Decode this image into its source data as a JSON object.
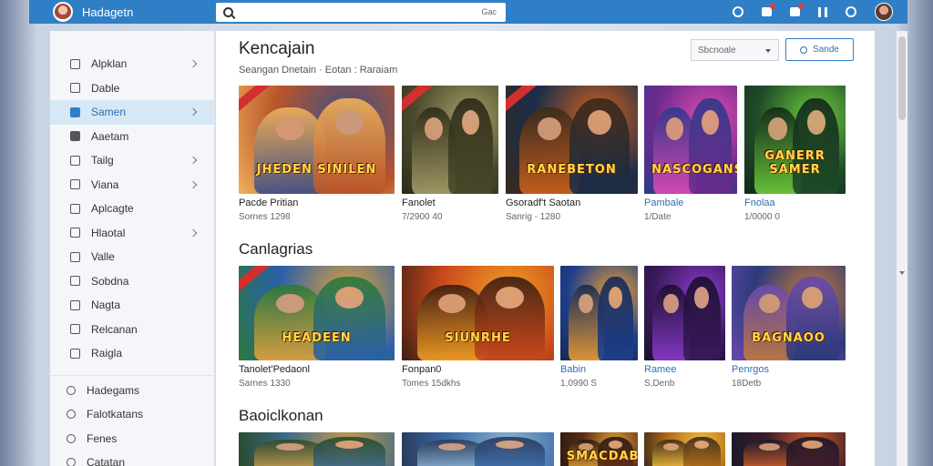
{
  "topbar": {
    "app_name": "Hadagetn",
    "search_placeholder": "",
    "search_hint": "Gac"
  },
  "sidebar": {
    "items": [
      {
        "label": "Alpklan",
        "icon": "grid-icon",
        "chevron": true
      },
      {
        "label": "Dable",
        "icon": "table-icon",
        "chevron": false
      },
      {
        "label": "Samen",
        "icon": "folder-icon",
        "chevron": true,
        "active": true
      },
      {
        "label": "Aaetam",
        "icon": "square-icon",
        "chevron": false
      },
      {
        "label": "Tailg",
        "icon": "tag-icon",
        "chevron": true
      },
      {
        "label": "Viana",
        "icon": "check-icon",
        "chevron": true
      },
      {
        "label": "Aplcagte",
        "icon": "app-icon",
        "chevron": false
      },
      {
        "label": "Hlaotal",
        "icon": "hotel-icon",
        "chevron": true
      },
      {
        "label": "Valle",
        "icon": "wallet-icon",
        "chevron": false
      },
      {
        "label": "Sobdna",
        "icon": "sound-icon",
        "chevron": false
      },
      {
        "label": "Nagta",
        "icon": "note-icon",
        "chevron": false
      },
      {
        "label": "Relcanan",
        "icon": "calendar-icon",
        "chevron": false
      },
      {
        "label": "Raigla",
        "icon": "image-icon",
        "chevron": false
      }
    ],
    "bottom_items": [
      {
        "label": "Hadegams",
        "icon": "settings-icon"
      },
      {
        "label": "Falotkatans",
        "icon": "feedback-icon"
      },
      {
        "label": "Fenes",
        "icon": "fence-icon"
      },
      {
        "label": "Catatan",
        "icon": "clock-icon"
      }
    ]
  },
  "main": {
    "title": "Kencajain",
    "subtitle": "Seangan Dnetain  ·  Eotan  :  Raraiam",
    "sort_label": "Sbcnoale",
    "find_label": "Sande",
    "sections": [
      {
        "title": "",
        "cards": [
          {
            "title": "Pacde Pritian",
            "meta": "Sornes 1298",
            "logo": "JHEDEN SINILEN",
            "colors": [
              "#b9542a",
              "#3b4f8a",
              "#f0b35a"
            ],
            "title_blue": false
          },
          {
            "title": "Fanolet",
            "meta": "7/2900 40",
            "logo": "",
            "colors": [
              "#4b4a2c",
              "#a7a06a",
              "#2d2a18"
            ],
            "title_blue": false
          },
          {
            "title": "Gsoradf't Saotan",
            "meta": "Sanrig - 1280",
            "logo": "RANEBETON",
            "colors": [
              "#1a2d4a",
              "#d4621a",
              "#3b2a1a"
            ],
            "title_blue": false
          },
          {
            "title": "Pambale",
            "meta": "1/Date",
            "logo": "NASCOGANS",
            "colors": [
              "#6b2b8c",
              "#e24bb4",
              "#2d3a8a"
            ],
            "title_blue": true
          },
          {
            "title": "Fnolaa",
            "meta": "1/0000 0",
            "logo": "GANERR SAMER",
            "colors": [
              "#1f4d2a",
              "#6fcf3c",
              "#13281a"
            ],
            "title_blue": true
          }
        ]
      },
      {
        "title": "Canlagrias",
        "cards": [
          {
            "title": "Tanolet'Pedaonl",
            "meta": "Sarnes 1330",
            "logo": "HEADEEN",
            "colors": [
              "#2a5fa8",
              "#e6a33a",
              "#2c7a3a"
            ],
            "title_blue": false
          },
          {
            "title": "Fonpan0",
            "meta": "Tomes 15dkhs",
            "logo": "SIUNRHE",
            "colors": [
              "#c9471c",
              "#f2a024",
              "#3a1e14"
            ],
            "title_blue": false
          },
          {
            "title": "Babin",
            "meta": "1,0990 S",
            "logo": "",
            "colors": [
              "#1d3f8a",
              "#f0a030",
              "#172a55"
            ],
            "title_blue": true
          },
          {
            "title": "Ramee",
            "meta": "S,Denb",
            "logo": "",
            "colors": [
              "#3a1a5c",
              "#8d3bd0",
              "#1a0f2e"
            ],
            "title_blue": true
          },
          {
            "title": "Penrgos",
            "meta": "18Detb",
            "logo": "BAGNAOO",
            "colors": [
              "#2c3a7a",
              "#c47a3a",
              "#6a4ab0"
            ],
            "title_blue": true
          }
        ]
      },
      {
        "title": "Baoiclkonan",
        "cards": [
          {
            "title": "",
            "meta": "",
            "logo": "",
            "colors": [
              "#3c6a8a",
              "#c79a4a",
              "#2a4a2a"
            ],
            "title_blue": false
          },
          {
            "title": "",
            "meta": "",
            "logo": "",
            "colors": [
              "#3a6aa8",
              "#8ab0d0",
              "#2a3a5a"
            ],
            "title_blue": false
          },
          {
            "title": "",
            "meta": "",
            "logo": "SMACDAB",
            "colors": [
              "#5a2a1a",
              "#e0a030",
              "#2a1a10"
            ],
            "title_blue": false
          },
          {
            "title": "",
            "meta": "",
            "logo": "",
            "colors": [
              "#b06a1a",
              "#f2c040",
              "#3a2a1a"
            ],
            "title_blue": false
          },
          {
            "title": "",
            "meta": "",
            "logo": "",
            "colors": [
              "#3a1a2a",
              "#d0602a",
              "#1a1a2a"
            ],
            "title_blue": false
          }
        ]
      }
    ]
  }
}
